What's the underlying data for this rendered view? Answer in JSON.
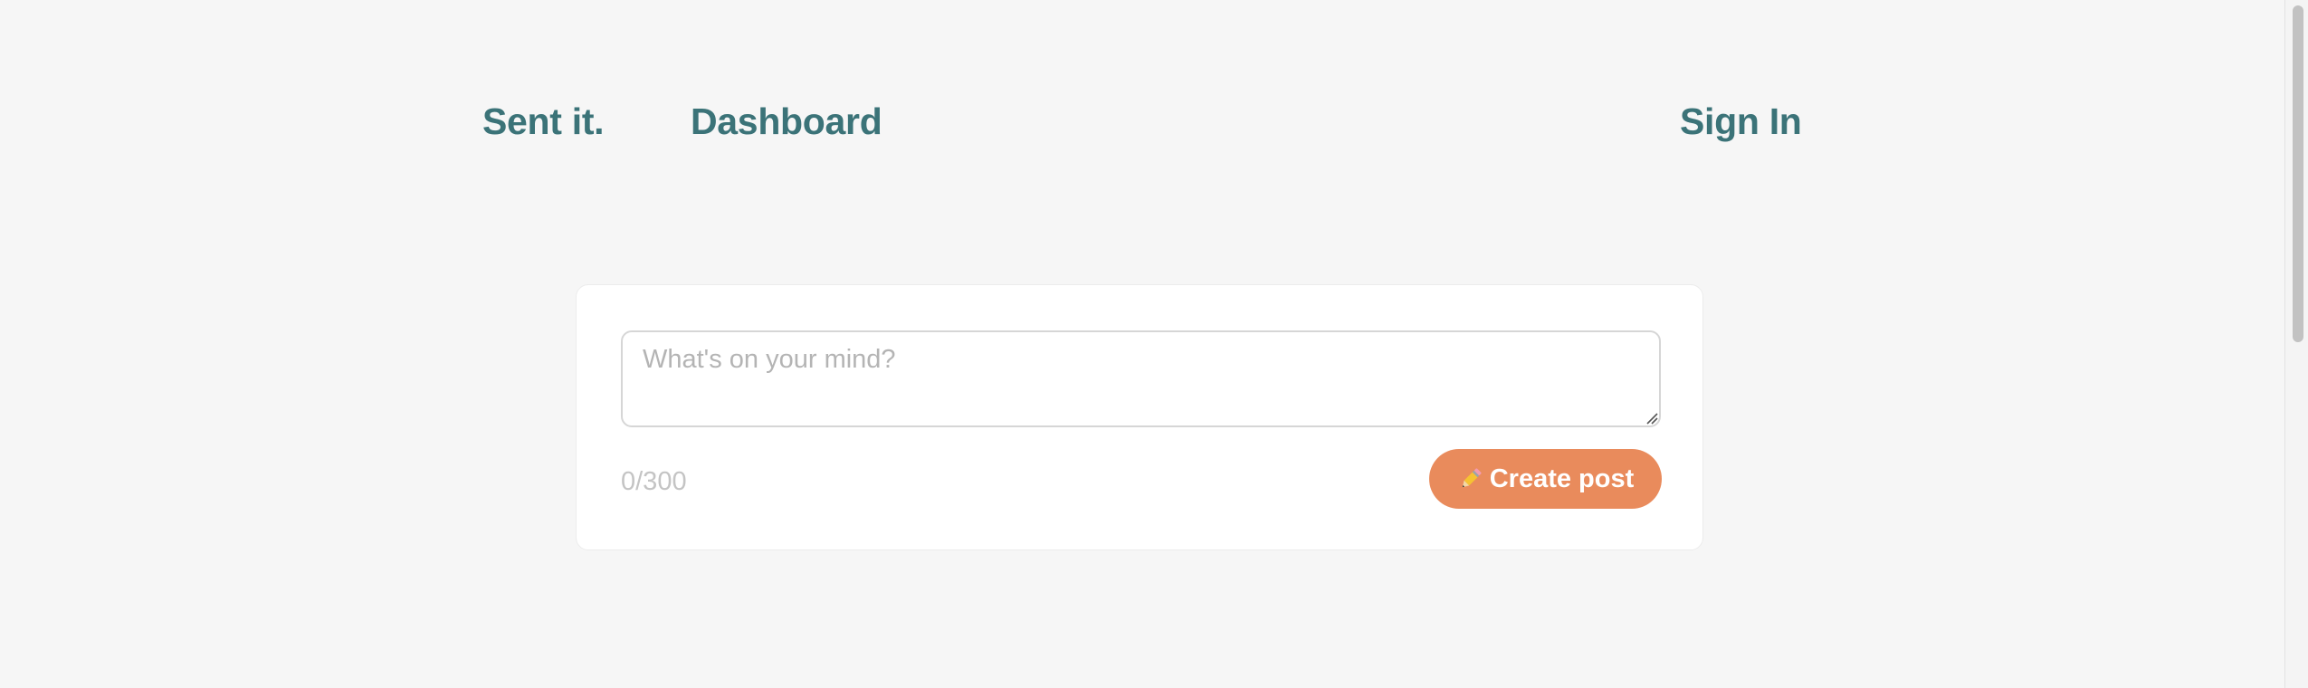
{
  "nav": {
    "brand": "Sent it.",
    "dashboard": "Dashboard",
    "sign_in": "Sign In"
  },
  "composer": {
    "placeholder": "What's on your mind?",
    "value": "",
    "char_count": "0/300",
    "create_button_label": "Create post",
    "create_button_icon": "pencil-icon"
  },
  "colors": {
    "nav_text": "#3b7378",
    "button_bg": "#e98b5c",
    "page_bg": "#f6f6f6"
  }
}
